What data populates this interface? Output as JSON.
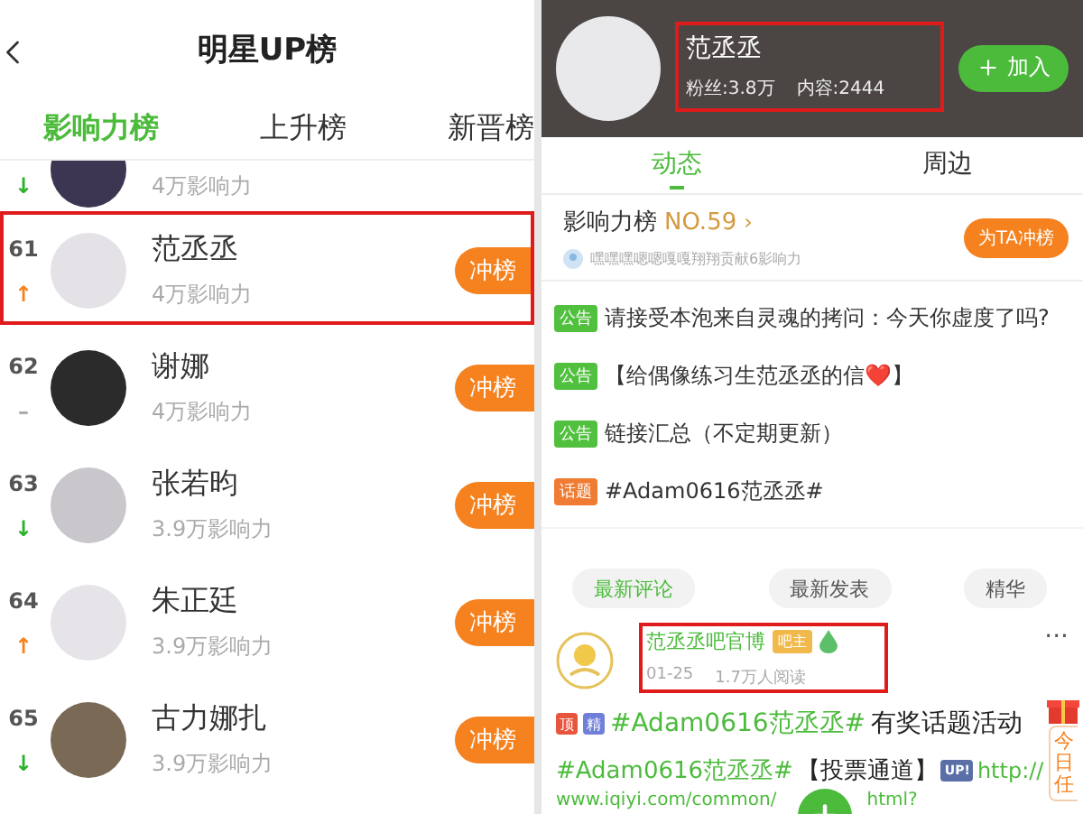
{
  "left": {
    "title": "明星UP榜",
    "tabs": [
      {
        "label": "影响力榜",
        "selected": true
      },
      {
        "label": "上升榜",
        "selected": false
      },
      {
        "label": "新晋榜",
        "selected": false
      }
    ],
    "rows": [
      {
        "kind": "partial",
        "influence": "4万影响力",
        "trend": "↓",
        "color": "#2bb12b"
      },
      {
        "kind": "full",
        "rank": "61",
        "name": "范丞丞",
        "influence": "4万影响力",
        "trend": "↑",
        "color": "#f5821f",
        "highlighted": true,
        "button": "冲榜"
      },
      {
        "kind": "full",
        "rank": "62",
        "name": "谢娜",
        "influence": "4万影响力",
        "trend": "–",
        "color": "#aaaaaa",
        "highlighted": false,
        "button": "冲榜"
      },
      {
        "kind": "full",
        "rank": "63",
        "name": "张若昀",
        "influence": "3.9万影响力",
        "trend": "↓",
        "color": "#2bb12b",
        "highlighted": false,
        "button": "冲榜"
      },
      {
        "kind": "full",
        "rank": "64",
        "name": "朱正廷",
        "influence": "3.9万影响力",
        "trend": "↑",
        "color": "#f5821f",
        "highlighted": false,
        "button": "冲榜"
      },
      {
        "kind": "full",
        "rank": "65",
        "name": "古力娜扎",
        "influence": "3.9万影响力",
        "trend": "↓",
        "color": "#2bb12b",
        "highlighted": false,
        "button": "冲榜"
      }
    ]
  },
  "right": {
    "header": {
      "name": "范丞丞",
      "fans": "粉丝:3.8万",
      "content": "内容:2444",
      "join_button": "加入",
      "highlighted": true
    },
    "tabs": [
      {
        "label": "动态",
        "selected": true
      },
      {
        "label": "周边",
        "selected": false
      }
    ],
    "influence": {
      "label": "影响力榜",
      "rank": "NO.59",
      "arrow": "›",
      "contributor": "嘿嘿嘿嗯嗯嘎嘎翔翔贡献6影响力",
      "button": "为TA冲榜"
    },
    "notices": [
      {
        "tag": "公告",
        "color": "#52c03f",
        "text": "请接受本泡来自灵魂的拷问：今天你虚度了吗?"
      },
      {
        "tag": "公告",
        "color": "#52c03f",
        "text": "【给偶像练习生范丞丞的信❤️】"
      },
      {
        "tag": "公告",
        "color": "#52c03f",
        "text": "链接汇总（不定期更新）"
      },
      {
        "tag": "话题",
        "color": "#f07c33",
        "text": "#Adam0616范丞丞#"
      }
    ],
    "filters": [
      {
        "label": "最新评论",
        "selected": true
      },
      {
        "label": "最新发表",
        "selected": false
      },
      {
        "label": "精华",
        "selected": false
      }
    ],
    "post": {
      "author": "范丞丞吧官博",
      "badge": "吧主",
      "date": "01-25",
      "reads": "1.7万人阅读",
      "highlighted": true,
      "more": "···",
      "title_tags": [
        {
          "label": "顶",
          "color": "#e8553e"
        },
        {
          "label": "精",
          "color": "#7080d8"
        }
      ],
      "title_hashtag": "#Adam0616范丞丞#",
      "title": "有奖话题活动",
      "body_hashtag": "#Adam0616范丞丞#",
      "body_text": "【投票通道】",
      "body_badge": "UP!",
      "link_parts": [
        "http://",
        "www.iqiyi.com/common/",
        "html?"
      ]
    },
    "task_tab": "今日任"
  }
}
